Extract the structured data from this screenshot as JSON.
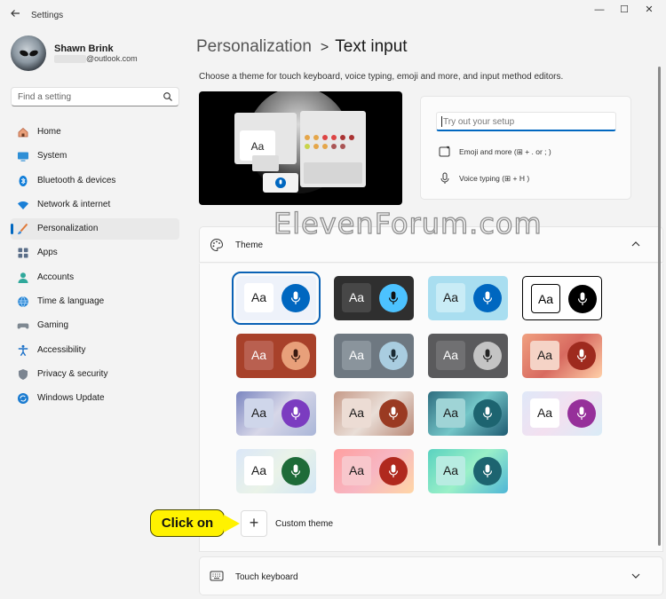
{
  "window": {
    "title": "Settings",
    "controls": {
      "minimize": "—",
      "maximize": "☐",
      "close": "✕"
    }
  },
  "profile": {
    "name": "Shawn Brink",
    "email_suffix": "@outlook.com"
  },
  "search": {
    "placeholder": "Find a setting"
  },
  "sidebar": {
    "items": [
      {
        "label": "Home",
        "icon": "home-icon"
      },
      {
        "label": "System",
        "icon": "system-icon"
      },
      {
        "label": "Bluetooth & devices",
        "icon": "bluetooth-icon"
      },
      {
        "label": "Network & internet",
        "icon": "network-icon"
      },
      {
        "label": "Personalization",
        "icon": "personalization-icon",
        "active": true
      },
      {
        "label": "Apps",
        "icon": "apps-icon"
      },
      {
        "label": "Accounts",
        "icon": "accounts-icon"
      },
      {
        "label": "Time & language",
        "icon": "time-language-icon"
      },
      {
        "label": "Gaming",
        "icon": "gaming-icon"
      },
      {
        "label": "Accessibility",
        "icon": "accessibility-icon"
      },
      {
        "label": "Privacy & security",
        "icon": "privacy-icon"
      },
      {
        "label": "Windows Update",
        "icon": "windows-update-icon"
      }
    ]
  },
  "header": {
    "breadcrumb_parent": "Personalization",
    "breadcrumb_separator": ">",
    "breadcrumb_current": "Text input",
    "description": "Choose a theme for touch keyboard, voice typing, emoji and more, and input method editors."
  },
  "preview": {
    "aa_label": "Aa"
  },
  "try_panel": {
    "placeholder": "Try out your setup",
    "emoji_label": "Emoji and more (",
    "emoji_keys": "⊞ + . or ; )",
    "voice_label": "Voice typing (",
    "voice_keys": "⊞ + H )"
  },
  "theme_section": {
    "label": "Theme",
    "tile_text": "Aa",
    "custom_theme_label": "Custom theme",
    "custom_button": "+",
    "tiles": [
      {
        "bg": "#eef2fa",
        "aa_bg": "#ffffff",
        "aa_fg": "#1a1a1a",
        "mic_bg": "#0067c0",
        "mic_fg": "#ffffff",
        "selected": true
      },
      {
        "bg": "#2f2f2f",
        "aa_bg": "#474747",
        "aa_fg": "#ffffff",
        "mic_bg": "#4cc2ff",
        "mic_fg": "#111111"
      },
      {
        "bg": "#a9def0",
        "aa_bg": "#c9ecf6",
        "aa_fg": "#1a1a1a",
        "mic_bg": "#0067c0",
        "mic_fg": "#ffffff"
      },
      {
        "bg": "#ffffff",
        "aa_bg": "#ffffff",
        "aa_fg": "#000000",
        "mic_bg": "#000000",
        "mic_fg": "#ffffff",
        "border": "#000000"
      },
      {
        "bg": "#a8412a",
        "aa_bg": "#b96050",
        "aa_fg": "#ffffff",
        "mic_bg": "#e8a07a",
        "mic_fg": "#3a1a10"
      },
      {
        "bg": "#6e7881",
        "aa_bg": "#8a949c",
        "aa_fg": "#ffffff",
        "mic_bg": "#a9cde0",
        "mic_fg": "#1a2a33"
      },
      {
        "bg": "#5a5a5c",
        "aa_bg": "#707072",
        "aa_fg": "#ffffff",
        "mic_bg": "#c4c4c4",
        "mic_fg": "#222222"
      },
      {
        "bg": "linear-gradient(135deg,#f0a080,#d86a60 50%,#ffd0a8)",
        "aa_bg": "#f5d3c6",
        "aa_fg": "#1a1a1a",
        "mic_bg": "#9e2a1e",
        "mic_fg": "#ffffff"
      },
      {
        "bg": "linear-gradient(135deg,#7b86c0,#d7d7e8 50%,#aab6d8)",
        "aa_bg": "#cfd6ea",
        "aa_fg": "#1a1a1a",
        "mic_bg": "#7b3cc0",
        "mic_fg": "#ffffff"
      },
      {
        "bg": "linear-gradient(135deg,#c69a88,#e9ded7 50%,#b98876)",
        "aa_bg": "#ecdcd4",
        "aa_fg": "#1a1a1a",
        "mic_bg": "#9a3a22",
        "mic_fg": "#ffffff"
      },
      {
        "bg": "linear-gradient(135deg,#2f6e80,#74c6c8 50%,#1e5b72)",
        "aa_bg": "#9fd4d6",
        "aa_fg": "#1a1a1a",
        "mic_bg": "#1d6470",
        "mic_fg": "#ffffff"
      },
      {
        "bg": "linear-gradient(135deg,#dfe8f8,#f3e0f0 50%,#d9ecf7)",
        "aa_bg": "#ffffff",
        "aa_fg": "#1a1a1a",
        "mic_bg": "#96309a",
        "mic_fg": "#ffffff"
      },
      {
        "bg": "linear-gradient(135deg,#dbe7f8,#eaf3e8 50%,#d2e6f5)",
        "aa_bg": "#ffffff",
        "aa_fg": "#1a1a1a",
        "mic_bg": "#1e6b38",
        "mic_fg": "#ffffff"
      },
      {
        "bg": "linear-gradient(135deg,#ff9f9f,#f7b6c2 50%,#ffd6a6)",
        "aa_bg": "#f8c7cc",
        "aa_fg": "#1a1a1a",
        "mic_bg": "#b0291e",
        "mic_fg": "#ffffff"
      },
      {
        "bg": "linear-gradient(135deg,#5ad2c0,#9af0c8 50%,#4fb6d6)",
        "aa_bg": "#b8ece2",
        "aa_fg": "#1a1a1a",
        "mic_bg": "#1d6470",
        "mic_fg": "#ffffff"
      }
    ]
  },
  "touch_keyboard": {
    "label": "Touch keyboard"
  },
  "callout": {
    "text": "Click on"
  },
  "watermark": {
    "text": "ElevenForum.com"
  },
  "colors": {
    "accent": "#0067c0",
    "callout": "#fff200"
  }
}
